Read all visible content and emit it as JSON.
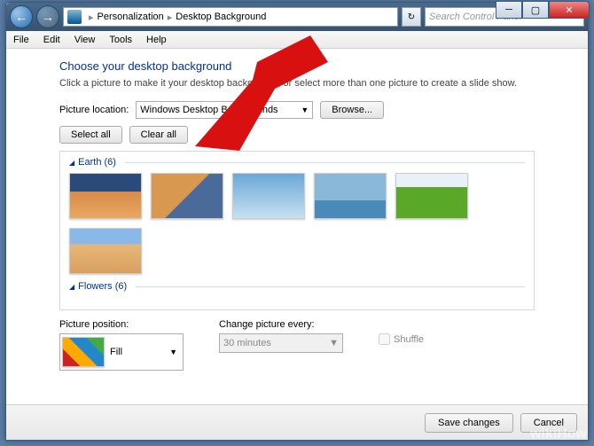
{
  "breadcrumb": {
    "item1": "Personalization",
    "item2": "Desktop Background"
  },
  "search": {
    "placeholder": "Search Control Panel"
  },
  "menu": {
    "file": "File",
    "edit": "Edit",
    "view": "View",
    "tools": "Tools",
    "help": "Help"
  },
  "heading": "Choose your desktop background",
  "subheading": "Click a picture to make it your desktop background, or select more than one picture to create a slide show.",
  "location": {
    "label": "Picture location:",
    "value": "Windows Desktop Backgrounds",
    "browse": "Browse..."
  },
  "buttons": {
    "selectAll": "Select all",
    "clearAll": "Clear all"
  },
  "groups": {
    "earth": "Earth (6)",
    "flowers": "Flowers (6)"
  },
  "position": {
    "label": "Picture position:",
    "value": "Fill"
  },
  "change": {
    "label": "Change picture every:",
    "value": "30 minutes"
  },
  "shuffle": "Shuffle",
  "footer": {
    "save": "Save changes",
    "cancel": "Cancel"
  },
  "watermark": "wikiHow"
}
